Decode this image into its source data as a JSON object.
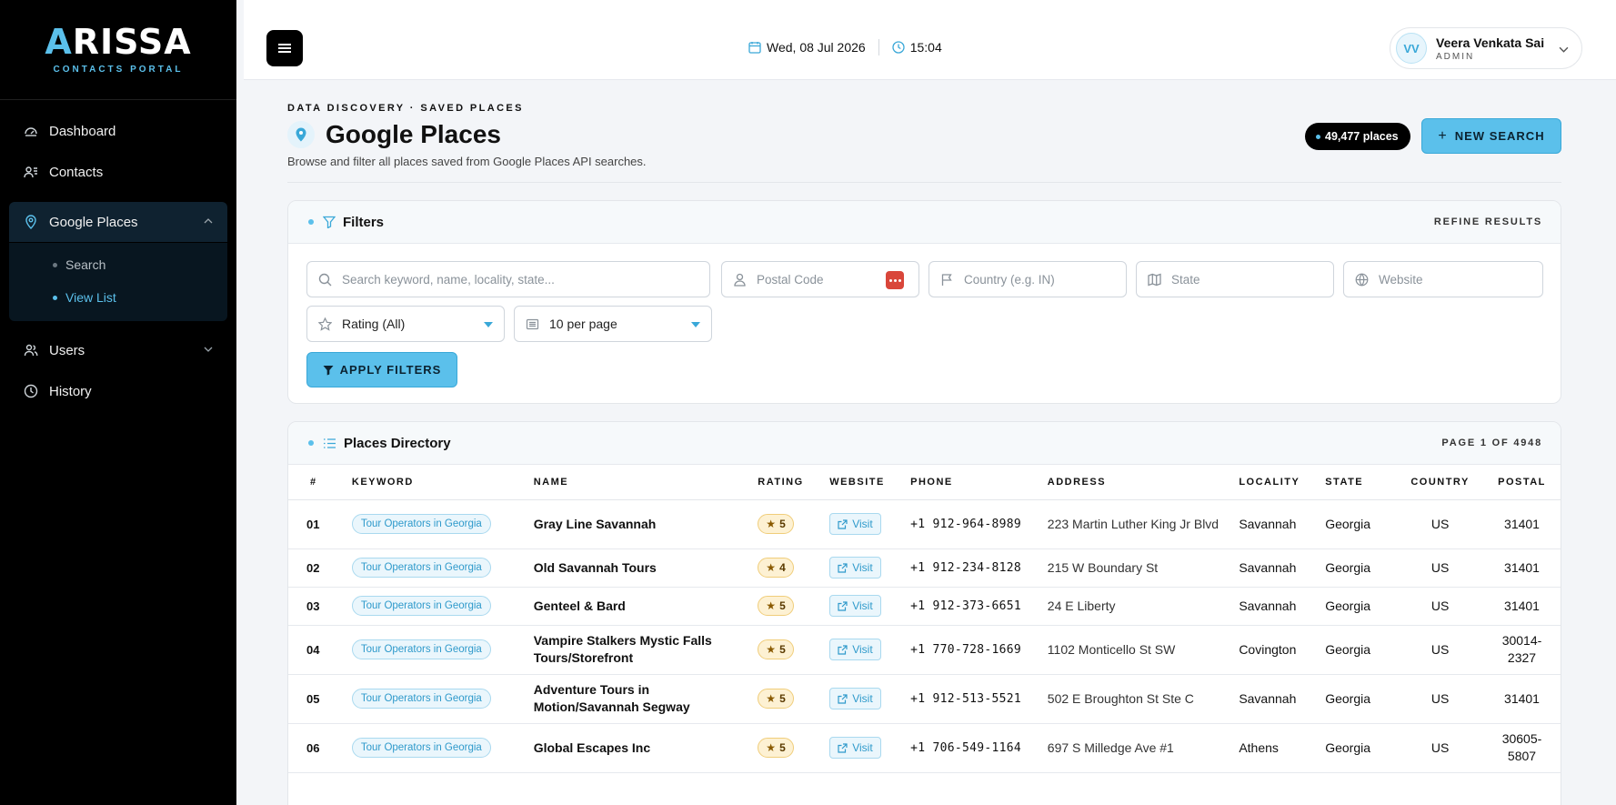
{
  "brand": {
    "name_a": "A",
    "name_rest": "RISSA",
    "subtitle": "CONTACTS PORTAL"
  },
  "sidebar": {
    "items": [
      {
        "label": "Dashboard",
        "icon": "gauge-icon"
      },
      {
        "label": "Contacts",
        "icon": "contacts-icon"
      },
      {
        "label": "Google Places",
        "icon": "map-pin-icon",
        "active": true,
        "children": [
          {
            "label": "Search"
          },
          {
            "label": "View List",
            "current": true
          }
        ]
      },
      {
        "label": "Users",
        "icon": "users-icon"
      },
      {
        "label": "History",
        "icon": "clock-icon"
      }
    ]
  },
  "topbar": {
    "date": "Wed, 08 Jul 2026",
    "time": "15:04",
    "user": {
      "initials": "VV",
      "name": "Veera Venkata Sai",
      "role": "ADMIN"
    }
  },
  "header": {
    "eyebrow": "DATA DISCOVERY · SAVED PLACES",
    "title": "Google Places",
    "subtitle": "Browse and filter all places saved from Google Places API searches.",
    "count_badge": "49,477 places",
    "new_search_label": "NEW SEARCH"
  },
  "filters": {
    "title": "Filters",
    "right_label": "REFINE RESULTS",
    "keyword_placeholder": "Search keyword, name, locality, state...",
    "postal_placeholder": "Postal Code",
    "country_placeholder": "Country (e.g. IN)",
    "state_placeholder": "State",
    "website_placeholder": "Website",
    "rating_value": "Rating (All)",
    "per_page_value": "10 per page",
    "apply_label": "APPLY FILTERS"
  },
  "directory": {
    "title": "Places Directory",
    "page_label": "PAGE 1 OF 4948",
    "columns": [
      "#",
      "KEYWORD",
      "NAME",
      "RATING",
      "WEBSITE",
      "PHONE",
      "ADDRESS",
      "LOCALITY",
      "STATE",
      "COUNTRY",
      "POSTAL"
    ],
    "visit_label": "Visit",
    "rows": [
      {
        "n": "01",
        "keyword": "Tour Operators in Georgia",
        "name": "Gray Line Savannah",
        "rating": "5",
        "phone": "+1 912-964-8989",
        "address": "223 Martin Luther King Jr Blvd",
        "locality": "Savannah",
        "state": "Georgia",
        "country": "US",
        "postal": "31401"
      },
      {
        "n": "02",
        "keyword": "Tour Operators in Georgia",
        "name": "Old Savannah Tours",
        "rating": "4",
        "phone": "+1 912-234-8128",
        "address": "215 W Boundary St",
        "locality": "Savannah",
        "state": "Georgia",
        "country": "US",
        "postal": "31401"
      },
      {
        "n": "03",
        "keyword": "Tour Operators in Georgia",
        "name": "Genteel & Bard",
        "rating": "5",
        "phone": "+1 912-373-6651",
        "address": "24 E Liberty",
        "locality": "Savannah",
        "state": "Georgia",
        "country": "US",
        "postal": "31401"
      },
      {
        "n": "04",
        "keyword": "Tour Operators in Georgia",
        "name": "Vampire Stalkers Mystic Falls Tours/Storefront",
        "rating": "5",
        "phone": "+1 770-728-1669",
        "address": "1102 Monticello St SW",
        "locality": "Covington",
        "state": "Georgia",
        "country": "US",
        "postal": "30014-2327"
      },
      {
        "n": "05",
        "keyword": "Tour Operators in Georgia",
        "name": "Adventure Tours in Motion/Savannah Segway",
        "rating": "5",
        "phone": "+1 912-513-5521",
        "address": "502 E Broughton St Ste C",
        "locality": "Savannah",
        "state": "Georgia",
        "country": "US",
        "postal": "31401"
      },
      {
        "n": "06",
        "keyword": "Tour Operators in Georgia",
        "name": "Global Escapes Inc",
        "rating": "5",
        "phone": "+1 706-549-1164",
        "address": "697 S Milledge Ave #1",
        "locality": "Athens",
        "state": "Georgia",
        "country": "US",
        "postal": "30605-5807"
      }
    ]
  }
}
